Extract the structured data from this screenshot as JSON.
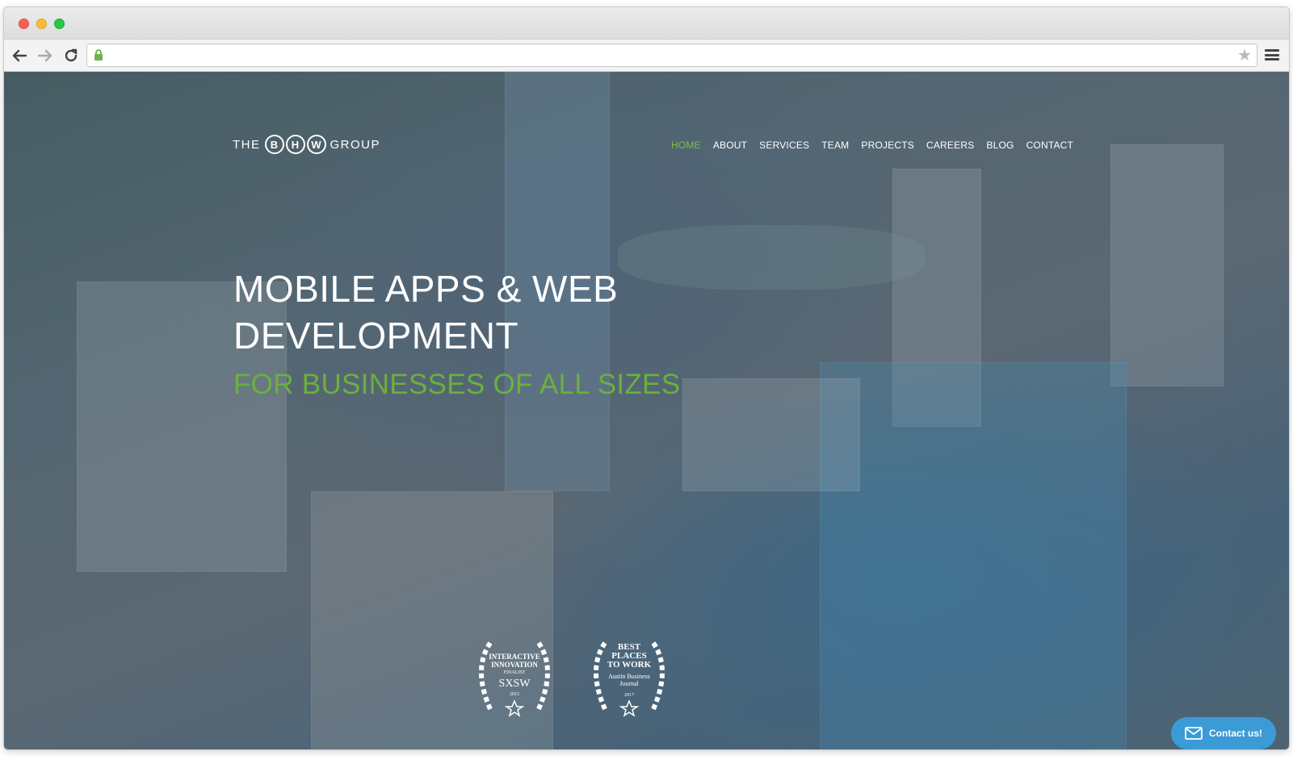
{
  "browser": {
    "url": "",
    "bookmark_icon": "star-icon",
    "menu_icon": "hamburger-icon"
  },
  "site": {
    "logo": {
      "prefix": "THE",
      "letters": [
        "B",
        "H",
        "W"
      ],
      "suffix": "GROUP"
    },
    "nav": [
      {
        "label": "HOME",
        "active": true
      },
      {
        "label": "ABOUT",
        "active": false
      },
      {
        "label": "SERVICES",
        "active": false
      },
      {
        "label": "TEAM",
        "active": false
      },
      {
        "label": "PROJECTS",
        "active": false
      },
      {
        "label": "CAREERS",
        "active": false
      },
      {
        "label": "BLOG",
        "active": false
      },
      {
        "label": "CONTACT",
        "active": false
      }
    ],
    "hero": {
      "line1": "MOBILE APPS & WEB",
      "line2": "DEVELOPMENT",
      "tagline": "FOR BUSINESSES OF ALL SIZES"
    },
    "awards": [
      {
        "lines": [
          "INTERACTIVE",
          "INNOVATION",
          "FINALIST",
          "SXSW",
          "2015"
        ]
      },
      {
        "lines": [
          "BEST",
          "PLACES",
          "TO WORK",
          "Austin Business",
          "Journal",
          "2017"
        ]
      }
    ],
    "contact_button": "Contact us!"
  },
  "colors": {
    "accent": "#6ab03e",
    "nav_active": "#7bbd4a",
    "contact_bg": "#3a9bd6"
  }
}
